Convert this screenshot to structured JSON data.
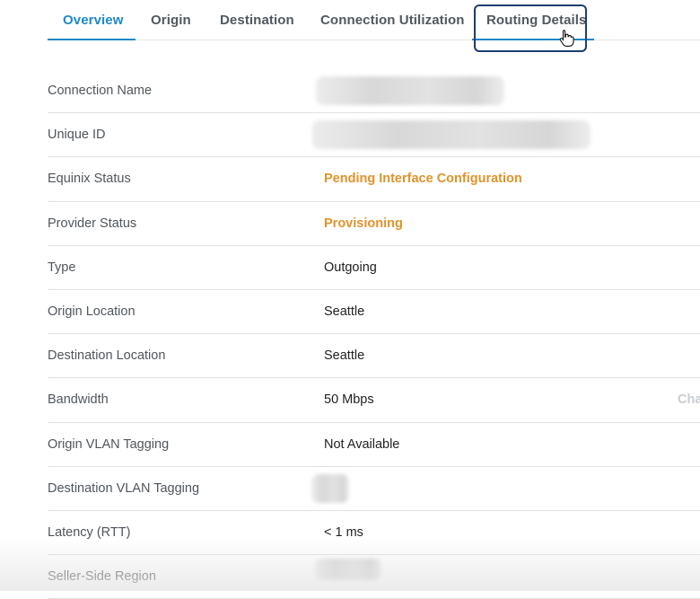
{
  "tabs": [
    {
      "label": "Overview",
      "active": true
    },
    {
      "label": "Origin",
      "active": false
    },
    {
      "label": "Destination",
      "active": false
    },
    {
      "label": "Connection Utilization",
      "active": false
    },
    {
      "label": "Routing Details",
      "active": false
    }
  ],
  "details": {
    "rows": [
      {
        "label": "Connection Name",
        "value": "",
        "redacted": true
      },
      {
        "label": "Unique ID",
        "value": "",
        "redacted": true
      },
      {
        "label": "Equinix Status",
        "value": "Pending Interface Configuration",
        "status": "pending"
      },
      {
        "label": "Provider Status",
        "value": "Provisioning",
        "status": "pending"
      },
      {
        "label": "Type",
        "value": "Outgoing"
      },
      {
        "label": "Origin Location",
        "value": "Seattle"
      },
      {
        "label": "Destination Location",
        "value": "Seattle"
      },
      {
        "label": "Bandwidth",
        "value": "50 Mbps",
        "link": "Cha"
      },
      {
        "label": "Origin VLAN Tagging",
        "value": "Not Available"
      },
      {
        "label": "Destination VLAN Tagging",
        "value": "",
        "redacted": true
      },
      {
        "label": "Latency (RTT)",
        "value": "< 1 ms"
      },
      {
        "label": "Seller-Side Region",
        "value": "",
        "redacted": true
      }
    ]
  },
  "colors": {
    "accent": "#1e88c9",
    "pending": "#e0932b",
    "focus_ring": "#1e3d6e"
  },
  "icons": {
    "cursor": "hand-pointer-icon"
  }
}
